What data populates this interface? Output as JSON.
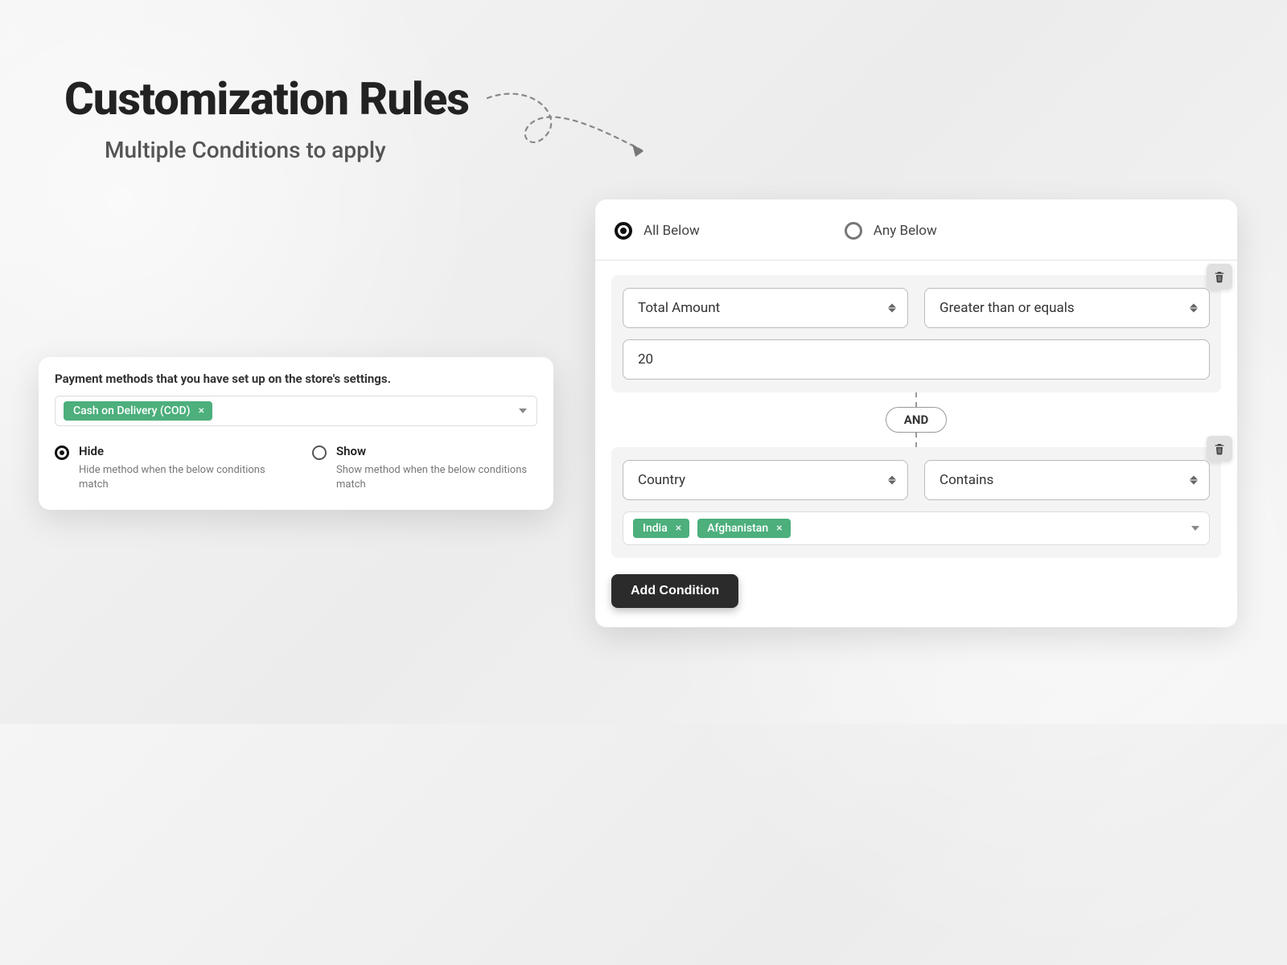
{
  "header": {
    "title": "Customization Rules",
    "subtitle": "Multiple Conditions to apply"
  },
  "paymentCard": {
    "sectionTitle": "Payment methods that you have set up on the store's settings.",
    "tags": [
      "Cash on Delivery (COD)"
    ],
    "visibility": {
      "hide": {
        "label": "Hide",
        "desc": "Hide method when the below conditions match",
        "selected": true
      },
      "show": {
        "label": "Show",
        "desc": "Show method when the below conditions match",
        "selected": false
      }
    }
  },
  "conditionsCard": {
    "mode": {
      "all": {
        "label": "All Below",
        "selected": true
      },
      "any": {
        "label": "Any Below",
        "selected": false
      }
    },
    "conditions": [
      {
        "field": "Total Amount",
        "operator": "Greater than or equals",
        "value": "20"
      },
      {
        "field": "Country",
        "operator": "Contains",
        "tags": [
          "India",
          "Afghanistan"
        ]
      }
    ],
    "connector": "AND",
    "addLabel": "Add Condition"
  }
}
